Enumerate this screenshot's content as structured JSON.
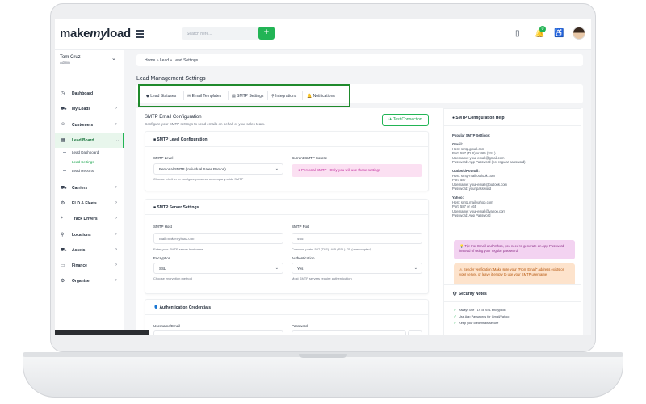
{
  "app": {
    "logo_make": "make",
    "logo_my": "my",
    "logo_load": "load"
  },
  "search": {
    "placeholder": "Search here...",
    "button": "+"
  },
  "topbar": {
    "notification_count": "0"
  },
  "user": {
    "name": "Tom Cruz",
    "role": "Admin"
  },
  "nav": [
    {
      "label": "Dashboard",
      "icon": "dashboard-icon",
      "glyph": "◷"
    },
    {
      "label": "My Loads",
      "icon": "truck-icon",
      "glyph": "⛟",
      "chevron": "›"
    },
    {
      "label": "Customers",
      "icon": "users-icon",
      "glyph": "☺",
      "chevron": "›"
    },
    {
      "label": "Lead Board",
      "icon": "chart-icon",
      "glyph": "▦",
      "chevron": "⌄"
    },
    {
      "label": "Carriers",
      "icon": "carrier-icon",
      "glyph": "⛟",
      "chevron": "›"
    },
    {
      "label": "ELD & Fleets",
      "icon": "fleet-icon",
      "glyph": "⚙",
      "chevron": "›"
    },
    {
      "label": "Track Drivers",
      "icon": "pin-icon",
      "glyph": "⌖",
      "chevron": "›"
    },
    {
      "label": "Locations",
      "icon": "location-icon",
      "glyph": "⚲",
      "chevron": "›"
    },
    {
      "label": "Assets",
      "icon": "assets-icon",
      "glyph": "⛟",
      "chevron": "›"
    },
    {
      "label": "Finance",
      "icon": "finance-icon",
      "glyph": "▭",
      "chevron": "›"
    },
    {
      "label": "Organise",
      "icon": "organise-icon",
      "glyph": "⚙",
      "chevron": "›"
    }
  ],
  "lead_board_sub": [
    "Lead Dashboard",
    "Lead Settings",
    "Lead Reports"
  ],
  "breadcrumb": "Home  »  Lead  »  Lead Settings",
  "page_title": "Lead Management Settings",
  "tabs": [
    {
      "label": "Lead Statuses",
      "glyph": "◆"
    },
    {
      "label": "Email Templates",
      "glyph": "✉"
    },
    {
      "label": "SMTP Settings",
      "glyph": "▤"
    },
    {
      "label": "Integrations",
      "glyph": "⚲"
    },
    {
      "label": "Notifications",
      "glyph": "🔔"
    }
  ],
  "smtp": {
    "title": "SMTP Email Configuration",
    "description": "Configure your SMTP settings to send emails on behalf of your sales team.",
    "test_button": "✈ Test Connection",
    "level_panel": {
      "title": "SMTP Level Configuration",
      "level_label": "SMTP Level",
      "level_value": "Personal SMTP (Individual Sales Person)",
      "level_help": "Choose whether to configure personal or company-wide SMTP",
      "source_label": "Current SMTP Source",
      "source_note": "Personal SMTP - Only you will use these settings"
    },
    "server_panel": {
      "title": "SMTP Server Settings",
      "host_label": "SMTP Host",
      "host_placeholder": "mail.makemyload.com",
      "host_help": "Enter your SMTP server hostname",
      "port_label": "SMTP Port",
      "port_placeholder": "465",
      "port_help": "Common ports: 587 (TLS), 465 (SSL), 25 (unencrypted)",
      "enc_label": "Encryption",
      "enc_value": "SSL",
      "enc_help": "Choose encryption method",
      "auth_label": "Authentication",
      "auth_value": "Yes",
      "auth_help": "Most SMTP servers require authentication"
    },
    "auth_panel": {
      "title": "Authentication Credentials",
      "username_label": "Username/Email",
      "password_label": "Password"
    }
  },
  "help": {
    "title": "SMTP Configuration Help",
    "popular": "Popular SMTP Settings:",
    "groups": [
      {
        "name": "Gmail:",
        "lines": [
          "Host: smtp.gmail.com",
          "Port: 587 (TLS) or 465 (SSL)",
          "Username: your-email@gmail.com",
          "Password: App Password (not regular password)"
        ]
      },
      {
        "name": "Outlook/Hotmail:",
        "lines": [
          "Host: smtp-mail.outlook.com",
          "Port: 587",
          "Username: your-email@outlook.com",
          "Password: your password"
        ]
      },
      {
        "name": "Yahoo:",
        "lines": [
          "Host: smtp.mail.yahoo.com",
          "Port: 587 or 465",
          "Username: your-email@yahoo.com",
          "Password: App Password"
        ]
      }
    ],
    "tip": "Tip: For Gmail and Yahoo, you need to generate an App Password instead of using your regular password.",
    "warning": "Sender verification: Make sure your \"From Email\" address exists on your server, or leave it empty to use your SMTP username."
  },
  "security": {
    "title": "Security Notes",
    "items": [
      "Always use TLS or SSL encryption",
      "Use App Passwords for Gmail/Yahoo",
      "Keep your credentials secure"
    ]
  },
  "colors": {
    "brand_green": "#22b455",
    "highlight_box": "#1f8a2c"
  }
}
